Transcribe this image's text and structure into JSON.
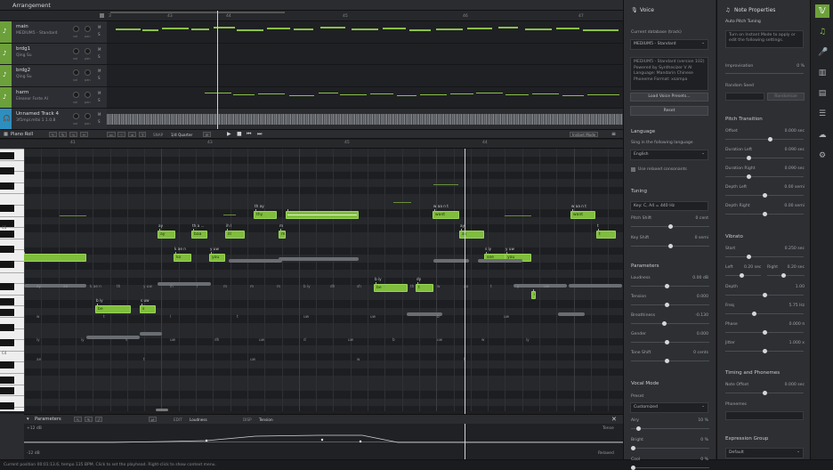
{
  "arrangement": {
    "title": "Arrangement",
    "ruler": [
      "3",
      "43",
      "44",
      "45",
      "46",
      "47"
    ],
    "tracks": [
      {
        "name": "main",
        "voice": "MEDIUM5 - Standard",
        "k1": "vol",
        "k2": "pan",
        "m": "M",
        "s": "S"
      },
      {
        "name": "brdg1",
        "voice": "Qing Su",
        "k1": "vol",
        "k2": "pan",
        "m": "M",
        "s": "S"
      },
      {
        "name": "brdg2",
        "voice": "Qing Su",
        "k1": "vol",
        "k2": "pan",
        "m": "M",
        "s": "S"
      },
      {
        "name": "harm",
        "voice": "Eleanor Forte AI",
        "k1": "vol",
        "k2": "pan",
        "m": "M",
        "s": "S"
      },
      {
        "name": "Unnamed Track 4",
        "voice": "3f1mpl.mfai  1 1.0.8",
        "k1": "vol",
        "k2": "pan",
        "m": "M",
        "s": "S"
      }
    ]
  },
  "pianoroll": {
    "title": "Piano Roll",
    "snap_label": "SNAP",
    "snap_value": "1/4 Quarter",
    "instant_mode": "Instant Mode",
    "ruler": [
      "41",
      "43",
      "45",
      "44"
    ],
    "c_labels": [
      "C5",
      "C4"
    ],
    "notes": [
      {
        "text": "",
        "lyric": ""
      },
      {
        "text": "ay",
        "lyric": "ay"
      },
      {
        "text": "ko",
        "lyric": "k ae n"
      },
      {
        "text": "baa",
        "lyric": "th a ..."
      },
      {
        "text": "you",
        "lyric": "y uw"
      },
      {
        "text": "ill",
        "lyric": "ih l"
      },
      {
        "text": "thy",
        "lyric": "th ay"
      },
      {
        "text": "",
        "lyric": ""
      },
      {
        "text": "m",
        "lyric": "m"
      },
      {
        "text": "be",
        "lyric": "b iy"
      },
      {
        "text": "s",
        "lyric": "s uw"
      },
      {
        "text": "be",
        "lyric": "b iy"
      },
      {
        "text": "t",
        "lyric": "dy"
      },
      {
        "text": "want",
        "lyric": "w aa n t"
      },
      {
        "text": "ay",
        "lyric": "ay"
      },
      {
        "text": "see",
        "lyric": "s iy"
      },
      {
        "text": "you",
        "lyric": "y uw"
      },
      {
        "text": "want",
        "lyric": "w aa n t"
      },
      {
        "text": "t",
        "lyric": "t"
      },
      {
        "text": "so",
        "lyric": "s uw"
      }
    ],
    "phoneme_rows": [
      [
        "ay",
        "ao",
        "k ae n",
        "th",
        "y uw",
        "ih",
        "l",
        "m",
        "m",
        "m",
        "b iy",
        "dh",
        "sh",
        "s",
        "th",
        "w",
        "ao",
        "t",
        "y",
        "uw"
      ],
      [
        "w",
        "t",
        "l",
        "t",
        "uw",
        "uw",
        "b",
        "uw"
      ],
      [
        "iy",
        "iy",
        "s",
        "uw",
        "dh",
        "uw",
        "d",
        "uw",
        "b",
        "uw",
        "w",
        "iy"
      ],
      [
        "ae",
        "t",
        "uw",
        "w",
        "t"
      ]
    ]
  },
  "parameters": {
    "title": "Parameters",
    "edit_label": "EDIT",
    "edit_value": "Loudness",
    "disp_label": "DISP",
    "disp_value": "Tension",
    "top_db": "+12 dB",
    "bottom_db": "-12 dB",
    "tense": "Tense",
    "relaxed": "Relaxed"
  },
  "status": "Current position 00:01:13.6, tempo 135 BPM. Click to set the playhead. Right-click to show context menu.",
  "voice": {
    "title": "Voice",
    "db_label": "Current database (track)",
    "db_value": "MEDIUM5 - Standard",
    "info": [
      "MEDIUM5 - Standard (version 102)",
      "Powered by Synthesizer V AI",
      "Language: Mandarin Chinese",
      "Phoneme Format: xsampa"
    ],
    "load_preset": "Load Voice Presets...",
    "reset": "Reset",
    "language_title": "Language",
    "sing_label": "Sing in the following language",
    "language_value": "English",
    "relaxed_consonants": "Use relaxed consonants",
    "tuning_title": "Tuning",
    "tuning_value": "Key: C, A4 = 440 Hz",
    "pitch_shift": "Pitch Shift",
    "pitch_shift_val": "0 cent",
    "key_shift": "Key Shift",
    "key_shift_val": "0 semi",
    "params_title": "Parameters",
    "params": [
      {
        "label": "Loudness",
        "value": "0.00 dB"
      },
      {
        "label": "Tension",
        "value": "0.000"
      },
      {
        "label": "Breathiness",
        "value": "-0.130"
      },
      {
        "label": "Gender",
        "value": "0.000"
      },
      {
        "label": "Tone Shift",
        "value": "0 cents"
      }
    ],
    "vocal_mode_title": "Vocal Mode",
    "preset_label": "Preset",
    "preset_value": "Customized",
    "modes": [
      {
        "label": "Airy",
        "value": "10 %"
      },
      {
        "label": "Bright",
        "value": "0 %"
      },
      {
        "label": "Cool",
        "value": "0 %"
      }
    ]
  },
  "note": {
    "title": "Note Properties",
    "auto_pitch": "Auto Pitch Tuning",
    "instant_msg": "Turn on Instant Mode to apply or edit the following settings.",
    "improvisation": "Improvisation",
    "improvisation_val": "0 %",
    "random_seed": "Random Seed",
    "randomize": "Randomize",
    "pitch_transition_title": "Pitch Transition",
    "transitions": [
      {
        "label": "Offset",
        "value": "0.000 sec"
      },
      {
        "label": "Duration Left",
        "value": "0.090 sec"
      },
      {
        "label": "Duration Right",
        "value": "0.090 sec"
      },
      {
        "label": "Depth Left",
        "value": "0.00 semi"
      },
      {
        "label": "Depth Right",
        "value": "0.00 semi"
      }
    ],
    "vibrato_title": "Vibrato",
    "start": "Start",
    "start_val": "0.250 sec",
    "left": "Left",
    "left_val": "0.20 sec",
    "right": "Right",
    "right_val": "0.20 sec",
    "vib": [
      {
        "label": "Depth",
        "value": "1.00"
      },
      {
        "label": "Freq",
        "value": "5.75 Hz"
      },
      {
        "label": "Phase",
        "value": "0.000 π"
      },
      {
        "label": "Jitter",
        "value": "1.000 x"
      }
    ],
    "timing_title": "Timing and Phonemes",
    "note_offset": "Note Offset",
    "note_offset_val": "0.000 sec",
    "phonemes": "Phonemes",
    "expr_title": "Expression Group",
    "expr_value": "Default"
  }
}
